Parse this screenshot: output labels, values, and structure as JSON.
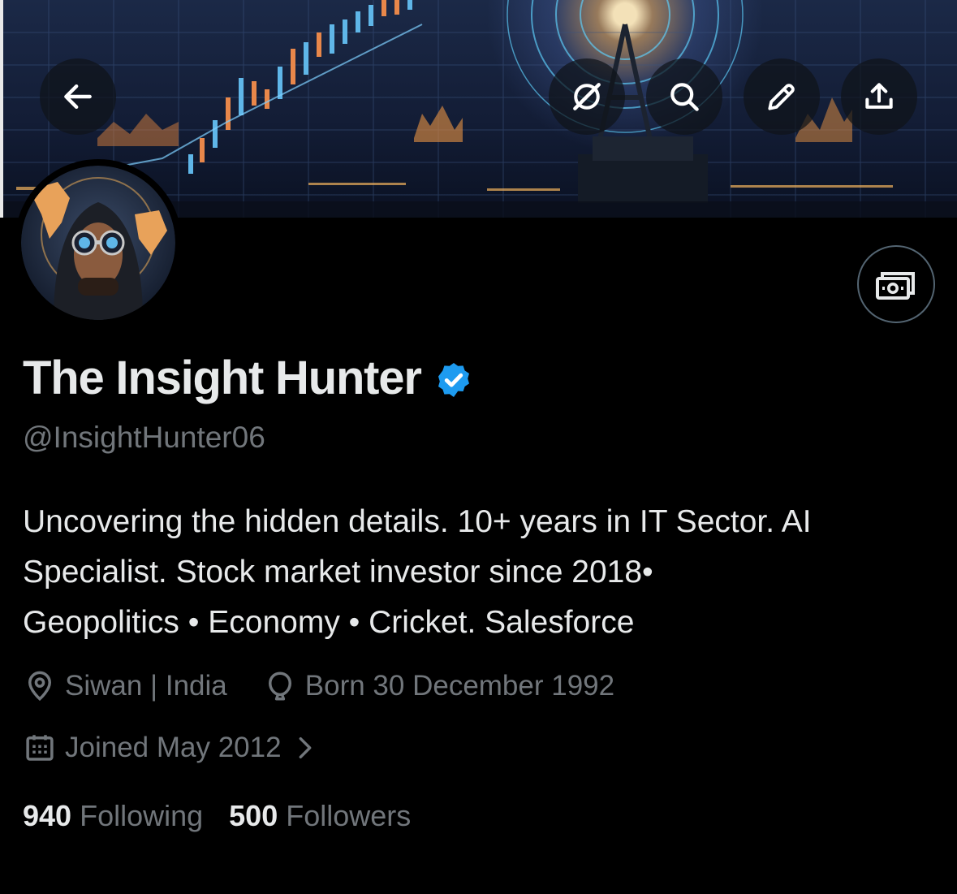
{
  "profile": {
    "display_name": "The Insight Hunter",
    "handle": "@InsightHunter06",
    "verified": true,
    "bio_lines": [
      "Uncovering the hidden details. 10+ years in IT Sector. AI",
      "Specialist. Stock market investor since 2018•",
      "Geopolitics • Economy • Cricket. Salesforce"
    ],
    "location": "Siwan | India",
    "birthday": "Born 30 December 1992",
    "joined": "Joined May 2012",
    "following_count": "940",
    "following_label": "Following",
    "followers_count": "500",
    "followers_label": "Followers"
  },
  "toolbar": {
    "back_icon": "arrow-left-icon",
    "actions": [
      "grok-icon",
      "search-icon",
      "edit-pencil-icon",
      "share-upload-icon"
    ]
  },
  "colors": {
    "background": "#000000",
    "primary_text": "#e7e9ea",
    "secondary_text": "#71767b",
    "verified_blue": "#1d9bf0"
  }
}
